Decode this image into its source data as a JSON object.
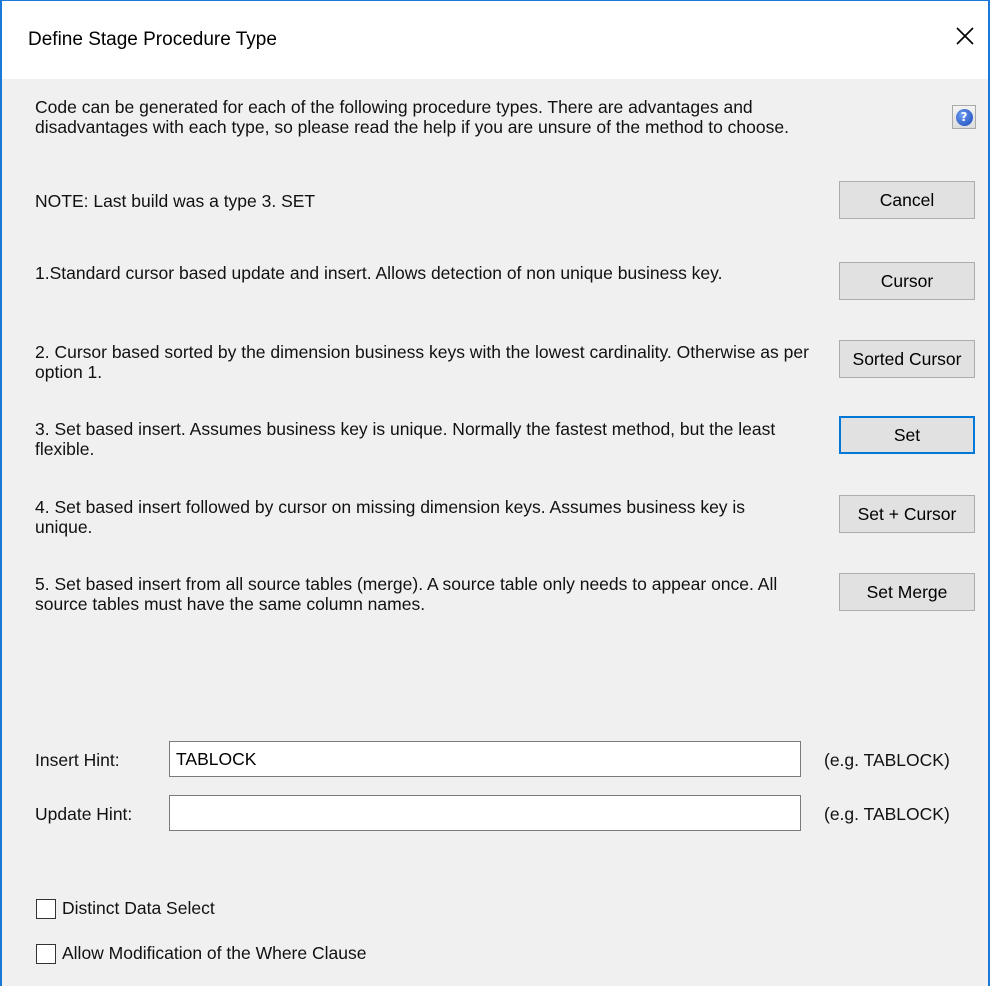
{
  "window": {
    "title": "Define Stage Procedure Type"
  },
  "intro": "Code can be generated for each of the following procedure types. There are advantages and disadvantages with each type, so please read the help if you are unsure of the method to choose.",
  "note": "NOTE: Last build was a type 3. SET",
  "options": [
    {
      "text": "1.Standard cursor based update and insert. Allows detection of non unique business key.",
      "button": "Cursor"
    },
    {
      "text": "2. Cursor based sorted by the dimension business keys with the lowest cardinality. Otherwise as per option 1.",
      "button": "Sorted Cursor"
    },
    {
      "text": "3. Set based insert. Assumes business key is unique. Normally the fastest method, but the least flexible.",
      "button": "Set"
    },
    {
      "text": "4. Set based insert followed by cursor on missing dimension keys. Assumes business key is unique.",
      "button": "Set + Cursor"
    },
    {
      "text": "5. Set based insert from all source tables (merge). A source table only needs to appear once. All source tables must have the same column names.",
      "button": "Set Merge"
    }
  ],
  "cancel_label": "Cancel",
  "insert_hint": {
    "label": "Insert Hint:",
    "value": "TABLOCK",
    "example": "(e.g. TABLOCK)"
  },
  "update_hint": {
    "label": "Update Hint:",
    "value": "",
    "example": "(e.g. TABLOCK)"
  },
  "checkboxes": [
    {
      "label": "Distinct Data Select",
      "checked": false
    },
    {
      "label": "Allow Modification of the Where Clause",
      "checked": false
    }
  ]
}
